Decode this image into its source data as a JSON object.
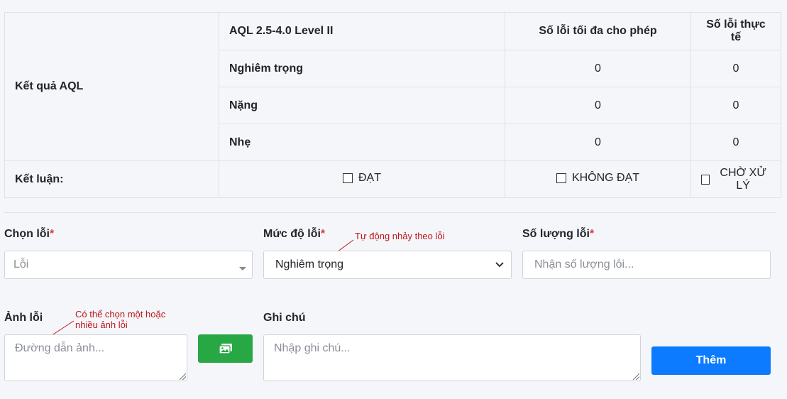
{
  "aql": {
    "row_label": "Kết quả AQL",
    "level_header": "AQL 2.5-4.0 Level II",
    "max_header": "Số lỗi tối đa cho phép",
    "actual_header": "Số lỗi thực tế",
    "rows": [
      {
        "label": "Nghiêm trọng",
        "max": "0",
        "actual": "0"
      },
      {
        "label": "Nặng",
        "max": "0",
        "actual": "0"
      },
      {
        "label": "Nhẹ",
        "max": "0",
        "actual": "0"
      }
    ],
    "conclusion_label": "Kết luận:",
    "options": [
      "ĐẠT",
      "KHÔNG ĐẠT",
      "CHỜ XỬ LÝ"
    ]
  },
  "form": {
    "error_label": "Chọn lỗi",
    "error_placeholder": "Lỗi",
    "severity_label": "Mức độ lỗi",
    "severity_value": "Nghiêm trọng",
    "severity_note": "Tự động nhảy theo lỗi",
    "qty_label": "Số lượng lỗi",
    "qty_placeholder": "Nhận số lượng lỗi...",
    "image_label": "Ảnh lỗi",
    "image_note_line1": "Có thể chọn một hoặc",
    "image_note_line2": "nhiều ảnh lỗi",
    "image_placeholder": "Đường dẫn ảnh...",
    "notes_label": "Ghi chú",
    "notes_placeholder": "Nhập ghi chú...",
    "required_mark": "*",
    "add_button": "Thêm"
  },
  "icons": {
    "image_button": "images-icon",
    "select_caret": "chevron-down-icon"
  },
  "colors": {
    "required": "#dc3545",
    "note": "#c0151c",
    "green_button": "#28a745",
    "blue_button": "#0d7bff"
  }
}
